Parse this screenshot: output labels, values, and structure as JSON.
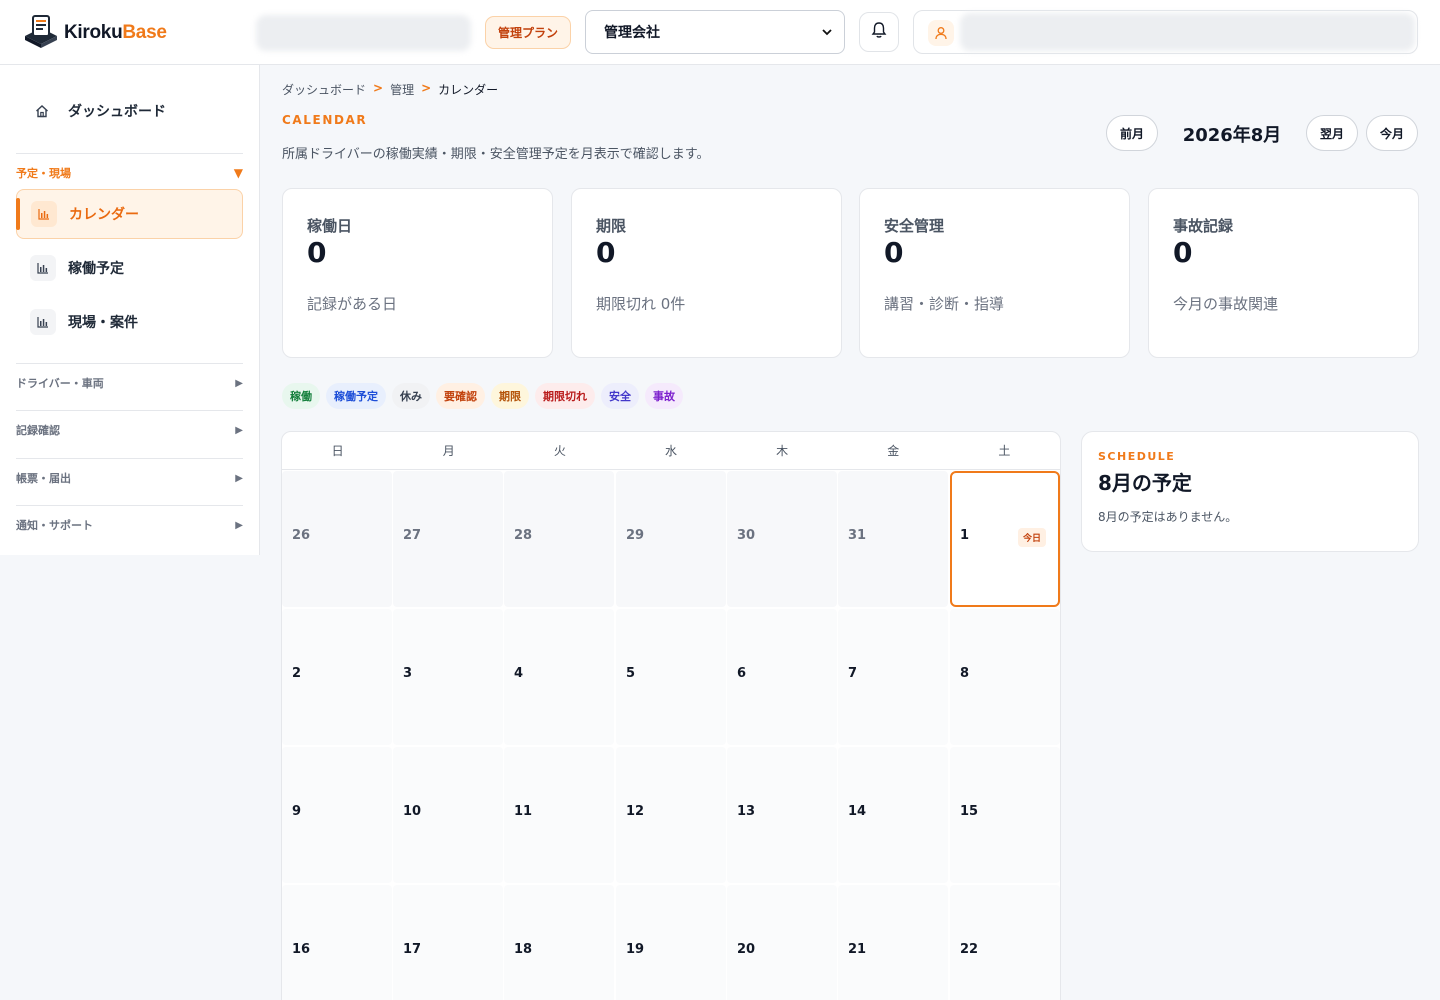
{
  "brand": {
    "name_main": "Kiroku",
    "name_accent": "Base"
  },
  "header": {
    "plan_badge": "管理プラン",
    "company_select": {
      "selected": "管理会社"
    }
  },
  "sidebar": {
    "dashboard": "ダッシュボード",
    "groups": [
      {
        "label": "予定・現場",
        "expanded": true,
        "arrow": "▼"
      },
      {
        "label": "ドライバー・車両",
        "arrow": "▶"
      },
      {
        "label": "記録確認",
        "arrow": "▶"
      },
      {
        "label": "帳票・届出",
        "arrow": "▶"
      },
      {
        "label": "通知・サポート",
        "arrow": "▶"
      }
    ],
    "items": [
      {
        "label": "カレンダー",
        "active": true
      },
      {
        "label": "稼働予定"
      },
      {
        "label": "現場・案件"
      }
    ]
  },
  "breadcrumb": {
    "items": [
      "ダッシュボード",
      "管理",
      "カレンダー"
    ],
    "sep": ">"
  },
  "page": {
    "eyebrow": "CALENDAR",
    "description": "所属ドライバーの稼働実績・期限・安全管理予定を月表示で確認します。"
  },
  "month_nav": {
    "prev": "前月",
    "current": "2026年8月",
    "next": "翌月",
    "today": "今月"
  },
  "stats": [
    {
      "label": "稼働日",
      "value": "0",
      "sub": "記録がある日"
    },
    {
      "label": "期限",
      "value": "0",
      "sub": "期限切れ 0件"
    },
    {
      "label": "安全管理",
      "value": "0",
      "sub": "講習・診断・指導"
    },
    {
      "label": "事故記録",
      "value": "0",
      "sub": "今月の事故関連"
    }
  ],
  "legend": [
    {
      "label": "稼働",
      "color": "#15803d",
      "bg": "#e8f7ee"
    },
    {
      "label": "稼働予定",
      "color": "#1d4ed8",
      "bg": "#e8effd"
    },
    {
      "label": "休み",
      "color": "#374151",
      "bg": "#f1f2f4"
    },
    {
      "label": "要確認",
      "color": "#c2410c",
      "bg": "#fff0e3"
    },
    {
      "label": "期限",
      "color": "#b45309",
      "bg": "#fef6dc"
    },
    {
      "label": "期限切れ",
      "color": "#b91c1c",
      "bg": "#fdecec"
    },
    {
      "label": "安全",
      "color": "#4338ca",
      "bg": "#edeefc"
    },
    {
      "label": "事故",
      "color": "#7e22ce",
      "bg": "#f5eafc"
    }
  ],
  "calendar": {
    "weekdays": [
      "日",
      "月",
      "火",
      "水",
      "木",
      "金",
      "土"
    ],
    "today_label": "今日",
    "weeks": [
      [
        "26",
        "27",
        "28",
        "29",
        "30",
        "31",
        "1"
      ],
      [
        "2",
        "3",
        "4",
        "5",
        "6",
        "7",
        "8"
      ],
      [
        "9",
        "10",
        "11",
        "12",
        "13",
        "14",
        "15"
      ],
      [
        "16",
        "17",
        "18",
        "19",
        "20",
        "21",
        "22"
      ]
    ]
  },
  "schedule": {
    "eyebrow": "SCHEDULE",
    "title": "8月の予定",
    "empty": "8月の予定はありません。"
  }
}
